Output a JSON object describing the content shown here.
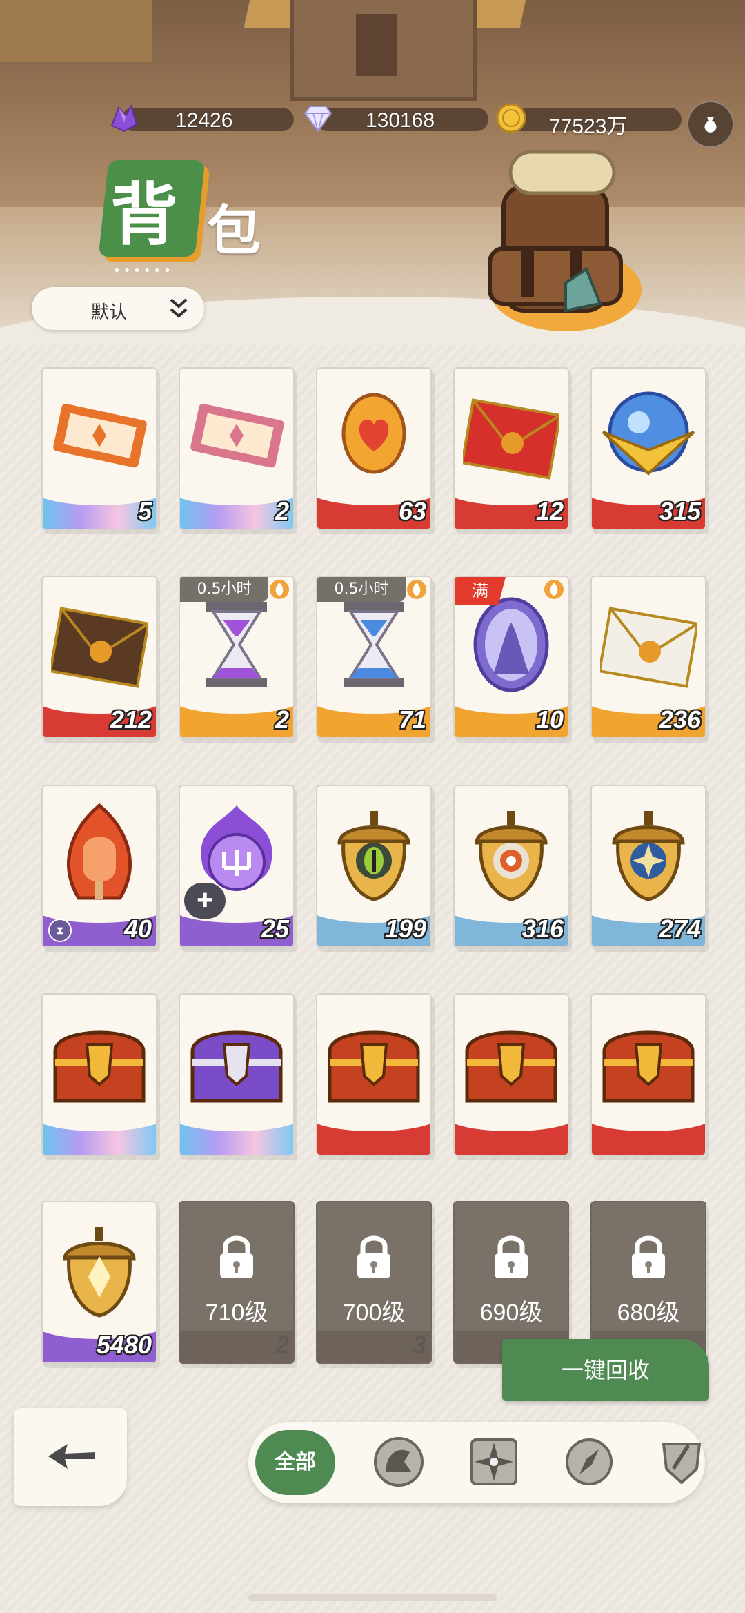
{
  "currencies": [
    {
      "name": "purple-crystal",
      "value": "12426"
    },
    {
      "name": "diamond",
      "value": "130168"
    },
    {
      "name": "gold-coin",
      "value": "77523万"
    }
  ],
  "header": {
    "title_main": "背",
    "title_sub": "包",
    "dots": "••••••"
  },
  "sort": {
    "label": "默认"
  },
  "items": [
    {
      "qty": "5",
      "floor": "blue",
      "icon": "ticket-orange-icon"
    },
    {
      "qty": "2",
      "floor": "blue",
      "icon": "ticket-pink-icon"
    },
    {
      "qty": "63",
      "floor": "red",
      "icon": "heart-amulet-icon"
    },
    {
      "qty": "12",
      "floor": "red",
      "icon": "envelope-red-icon"
    },
    {
      "qty": "315",
      "floor": "red",
      "icon": "crystal-orb-icon"
    },
    {
      "qty": "212",
      "floor": "red",
      "icon": "envelope-dark-icon"
    },
    {
      "qty": "2",
      "floor": "orange",
      "icon": "hourglass-purple-icon",
      "timer": "0.5小时"
    },
    {
      "qty": "71",
      "floor": "orange",
      "icon": "hourglass-blue-icon",
      "timer": "0.5小时"
    },
    {
      "qty": "10",
      "floor": "orange",
      "icon": "portrait-mirror-icon",
      "full": "满"
    },
    {
      "qty": "236",
      "floor": "orange",
      "icon": "envelope-white-icon"
    },
    {
      "qty": "40",
      "floor": "purple",
      "icon": "ice-pop-icon"
    },
    {
      "qty": "25",
      "floor": "purple",
      "icon": "trident-flame-icon"
    },
    {
      "qty": "199",
      "floor": "lblue",
      "icon": "acorn-eye-icon"
    },
    {
      "qty": "316",
      "floor": "lblue",
      "icon": "acorn-target-icon"
    },
    {
      "qty": "274",
      "floor": "lblue",
      "icon": "acorn-star-icon"
    },
    {
      "qty": "",
      "floor": "blue",
      "icon": "treasure-chest-gold-icon"
    },
    {
      "qty": "",
      "floor": "blue",
      "icon": "treasure-chest-mask-icon"
    },
    {
      "qty": "",
      "floor": "red",
      "icon": "treasure-chest-gold-icon"
    },
    {
      "qty": "",
      "floor": "red",
      "icon": "treasure-chest-gold-icon"
    },
    {
      "qty": "",
      "floor": "red",
      "icon": "treasure-chest-gold-icon"
    },
    {
      "qty": "5480",
      "floor": "purple",
      "icon": "acorn-gold-icon"
    }
  ],
  "locked_items": [
    {
      "level": "710级",
      "qty": "2"
    },
    {
      "level": "700级",
      "qty": "3"
    },
    {
      "level": "690级",
      "qty": ""
    },
    {
      "level": "680级",
      "qty": ""
    }
  ],
  "recycle_label": "一键回收",
  "tabs": {
    "all_label": "全部",
    "icons": [
      "helmet-icon",
      "shuriken-icon",
      "compass-icon",
      "shield-sword-icon"
    ]
  },
  "colors": {
    "accent_green": "#4f8a52",
    "title_green": "#4c8f49",
    "full_red": "#e23b2c"
  }
}
